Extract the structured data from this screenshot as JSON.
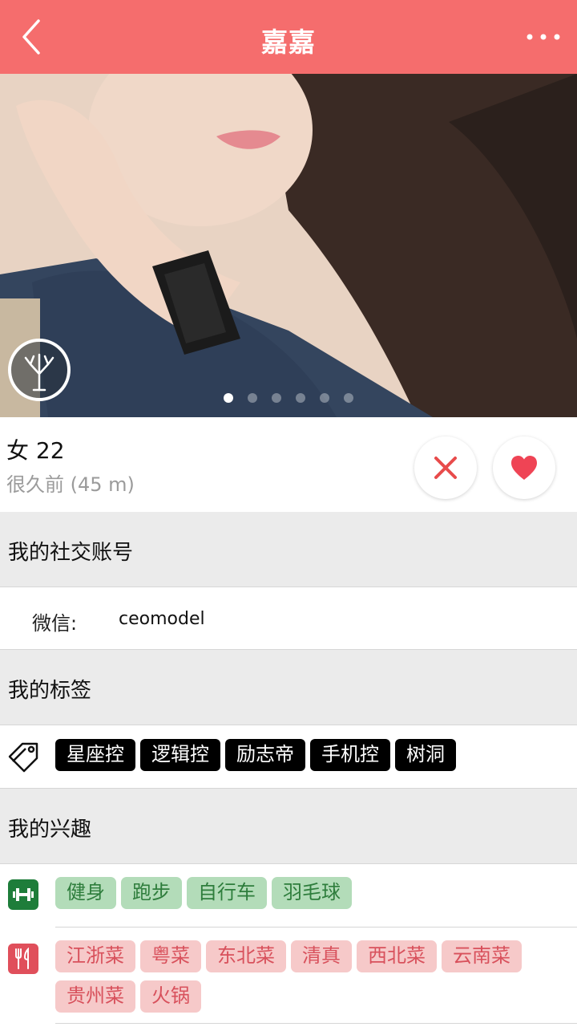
{
  "header": {
    "title": "嘉嘉",
    "back_icon": "back-chevron-icon",
    "more_icon": "more-dots-icon",
    "bar_color": "#f56d6d"
  },
  "photo": {
    "page_count": 6,
    "active_page": 1,
    "logo_icon": "tree-logo-icon"
  },
  "profile": {
    "gender_age": "女 22",
    "last_seen": "很久前 (45 m)",
    "dislike_icon": "close-x-icon",
    "like_icon": "heart-icon"
  },
  "social": {
    "section_title": "我的社交账号",
    "wechat_label": "微信:",
    "wechat_value": "ceomodel"
  },
  "tags": {
    "section_title": "我的标签",
    "icon": "tag-icon",
    "items": [
      "星座控",
      "逻辑控",
      "励志帝",
      "手机控",
      "树洞"
    ]
  },
  "interests": {
    "section_title": "我的兴趣",
    "sports": {
      "icon": "dumbbell-icon",
      "color": "#1e7d3a",
      "items": [
        "健身",
        "跑步",
        "自行车",
        "羽毛球"
      ]
    },
    "food": {
      "icon": "fork-knife-icon",
      "color": "#e04f5b",
      "items": [
        "江浙菜",
        "粤菜",
        "东北菜",
        "清真",
        "西北菜",
        "云南菜",
        "贵州菜",
        "火锅"
      ]
    }
  }
}
